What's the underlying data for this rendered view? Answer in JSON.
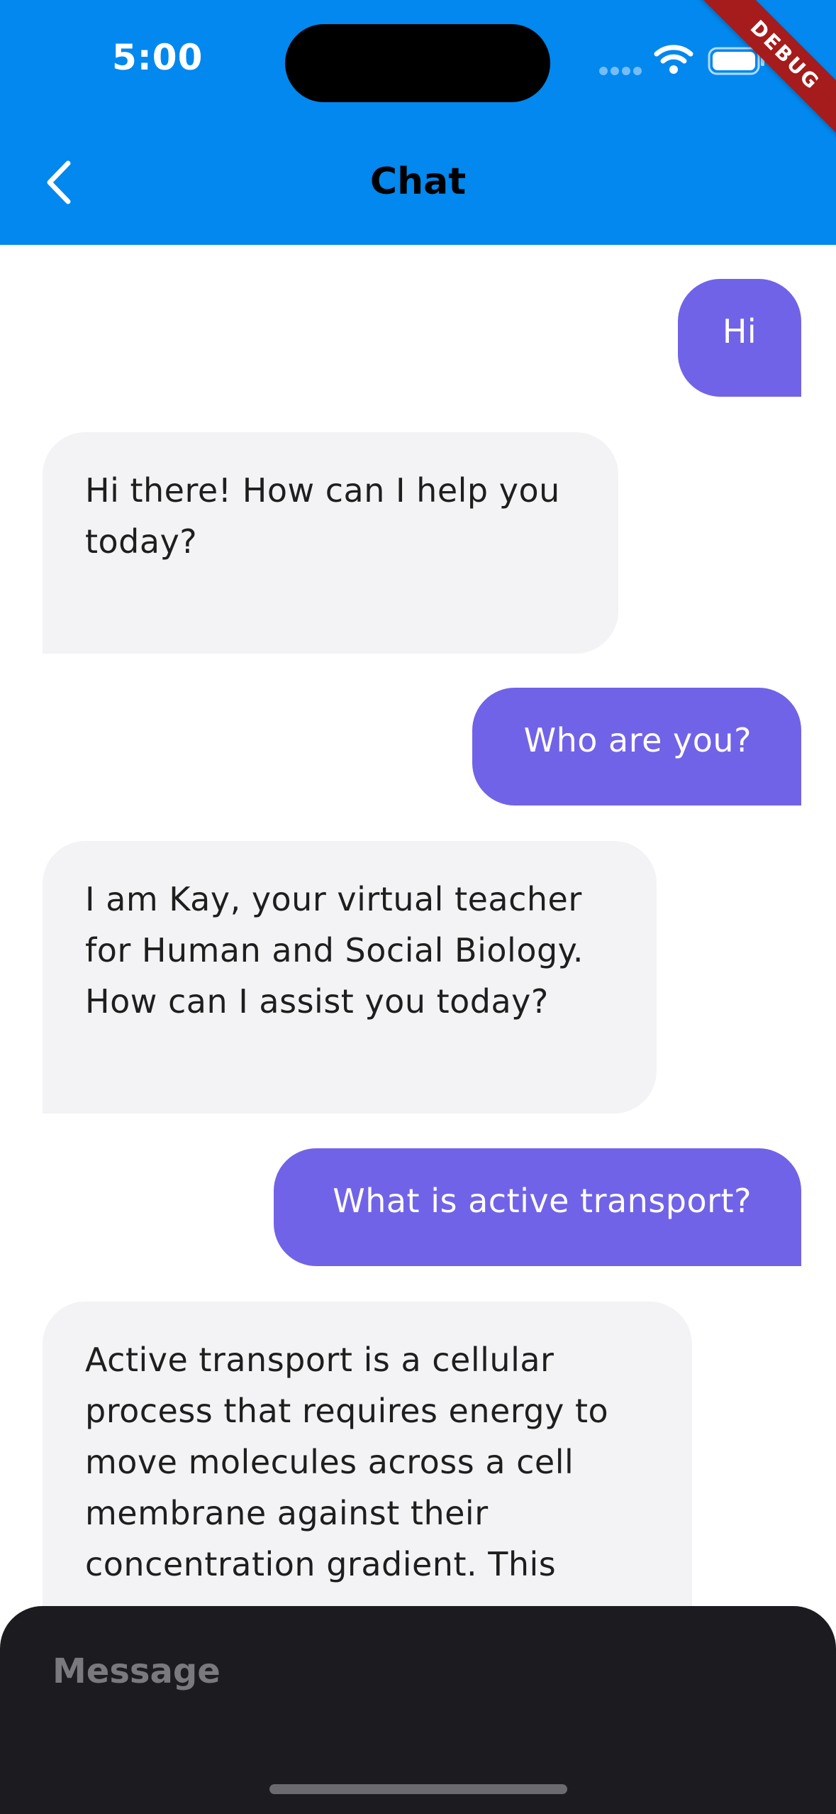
{
  "status_bar": {
    "time": "5:00",
    "debug_ribbon": "DEBUG"
  },
  "header": {
    "title": "Chat",
    "bg_color": "#0288ee"
  },
  "messages": [
    {
      "role": "user",
      "text": "Hi"
    },
    {
      "role": "assistant",
      "text": "Hi there! How can I help you today?"
    },
    {
      "role": "user",
      "text": "Who are you?"
    },
    {
      "role": "assistant",
      "text": "I am Kay, your virtual teacher for Human and Social Biology. How can I assist you today?"
    },
    {
      "role": "user",
      "text": "What is active transport?"
    },
    {
      "role": "assistant",
      "text": "Active transport is a cellular process that requires energy to move molecules across a cell membrane against their concentration gradient. This"
    }
  ],
  "composer": {
    "placeholder": "Message"
  },
  "colors": {
    "user_bubble": "#7163e7",
    "assistant_bubble": "#f3f3f5",
    "composer_bg": "#1c1b20"
  }
}
